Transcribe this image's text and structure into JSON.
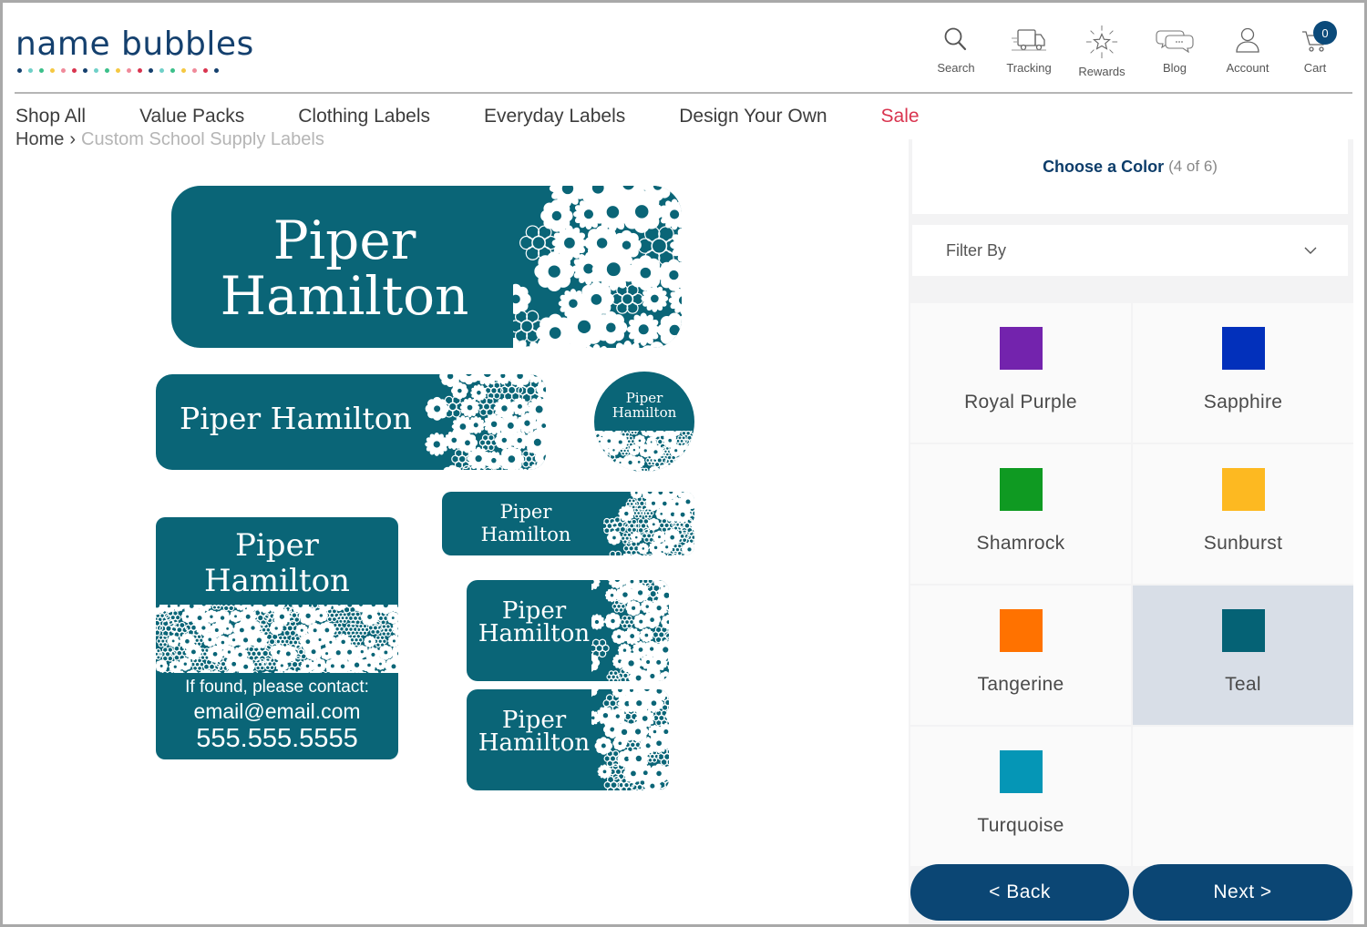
{
  "logo": {
    "text": "name bubbles",
    "dot_colors": [
      "#14406e",
      "#6fd0c8",
      "#3cc08a",
      "#f5c842",
      "#f08a9a",
      "#d9344f",
      "#14406e",
      "#6fd0c8",
      "#3cc08a",
      "#f5c842",
      "#f08a9a",
      "#d9344f",
      "#14406e",
      "#6fd0c8",
      "#3cc08a",
      "#f5c842",
      "#f08a9a",
      "#d9344f",
      "#14406e"
    ]
  },
  "header_icons": [
    {
      "icon": "search-icon",
      "label": "Search"
    },
    {
      "icon": "truck-icon",
      "label": "Tracking"
    },
    {
      "icon": "star-burst-icon",
      "label": "Rewards"
    },
    {
      "icon": "chat-bubbles-icon",
      "label": "Blog"
    },
    {
      "icon": "user-icon",
      "label": "Account"
    },
    {
      "icon": "cart-icon",
      "label": "Cart",
      "badge": "0"
    }
  ],
  "nav": {
    "items": [
      "Shop All",
      "Value Packs",
      "Clothing Labels",
      "Everyday Labels",
      "Design Your Own",
      "Sale"
    ],
    "sale_color": "#d9344f"
  },
  "breadcrumb": {
    "home": "Home",
    "separator": "›",
    "current": "Custom School Supply Labels"
  },
  "preview": {
    "label_color": "#0a6577",
    "first_name": "Piper",
    "last_name": "Hamilton",
    "full_name": "Piper Hamilton",
    "contact_line": "If found, please contact:",
    "email": "email@email.com",
    "phone": "555.555.5555"
  },
  "panel": {
    "title": "Choose a Color",
    "step": "(4 of 6)",
    "filter_label": "Filter By",
    "colors": [
      {
        "name": "Royal Purple",
        "hex": "#7323ad",
        "selected": false
      },
      {
        "name": "Sapphire",
        "hex": "#0230bb",
        "selected": false
      },
      {
        "name": "Shamrock",
        "hex": "#0f9a22",
        "selected": false
      },
      {
        "name": "Sunburst",
        "hex": "#fdb921",
        "selected": false
      },
      {
        "name": "Tangerine",
        "hex": "#ff7200",
        "selected": false
      },
      {
        "name": "Teal",
        "hex": "#056275",
        "selected": true
      },
      {
        "name": "Turquoise",
        "hex": "#0596b6",
        "selected": false
      }
    ],
    "back_label": "< Back",
    "next_label": "Next >"
  }
}
